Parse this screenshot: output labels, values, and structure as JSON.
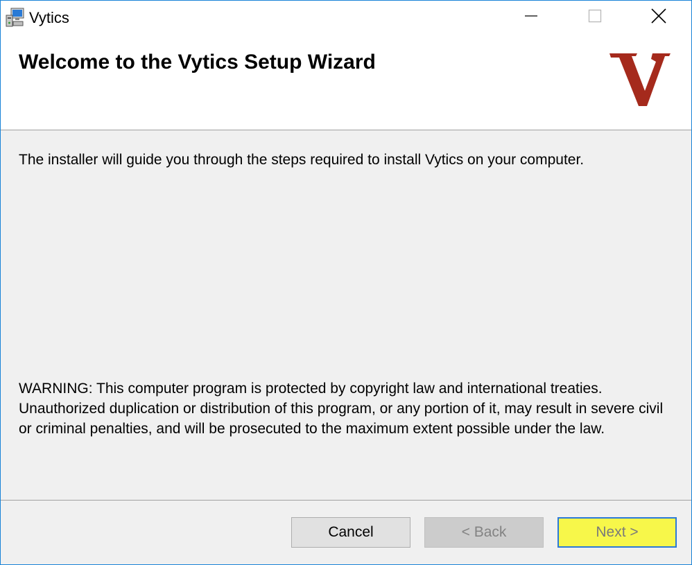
{
  "window": {
    "title": "Vytics",
    "app_icon": "installer-computer-icon"
  },
  "caption_buttons": {
    "minimize_icon": "minimize-icon",
    "maximize_icon": "maximize-icon",
    "close_icon": "close-icon"
  },
  "header": {
    "title": "Welcome to the Vytics Setup Wizard",
    "logo_letter": "V",
    "logo_color": "#a52a1c"
  },
  "body": {
    "intro": "The installer will guide you through the steps required to install Vytics on your computer.",
    "warning": "WARNING: This computer program is protected by copyright law and international treaties. Unauthorized duplication or distribution of this program, or any portion of it, may result in severe civil or criminal penalties, and will be prosecuted to the maximum extent possible under the law."
  },
  "buttons": {
    "cancel": "Cancel",
    "back": "< Back",
    "next": "Next >"
  },
  "colors": {
    "window_border": "#1883d7",
    "next_highlight": "#f7f74a",
    "next_border": "#2b79d8"
  }
}
